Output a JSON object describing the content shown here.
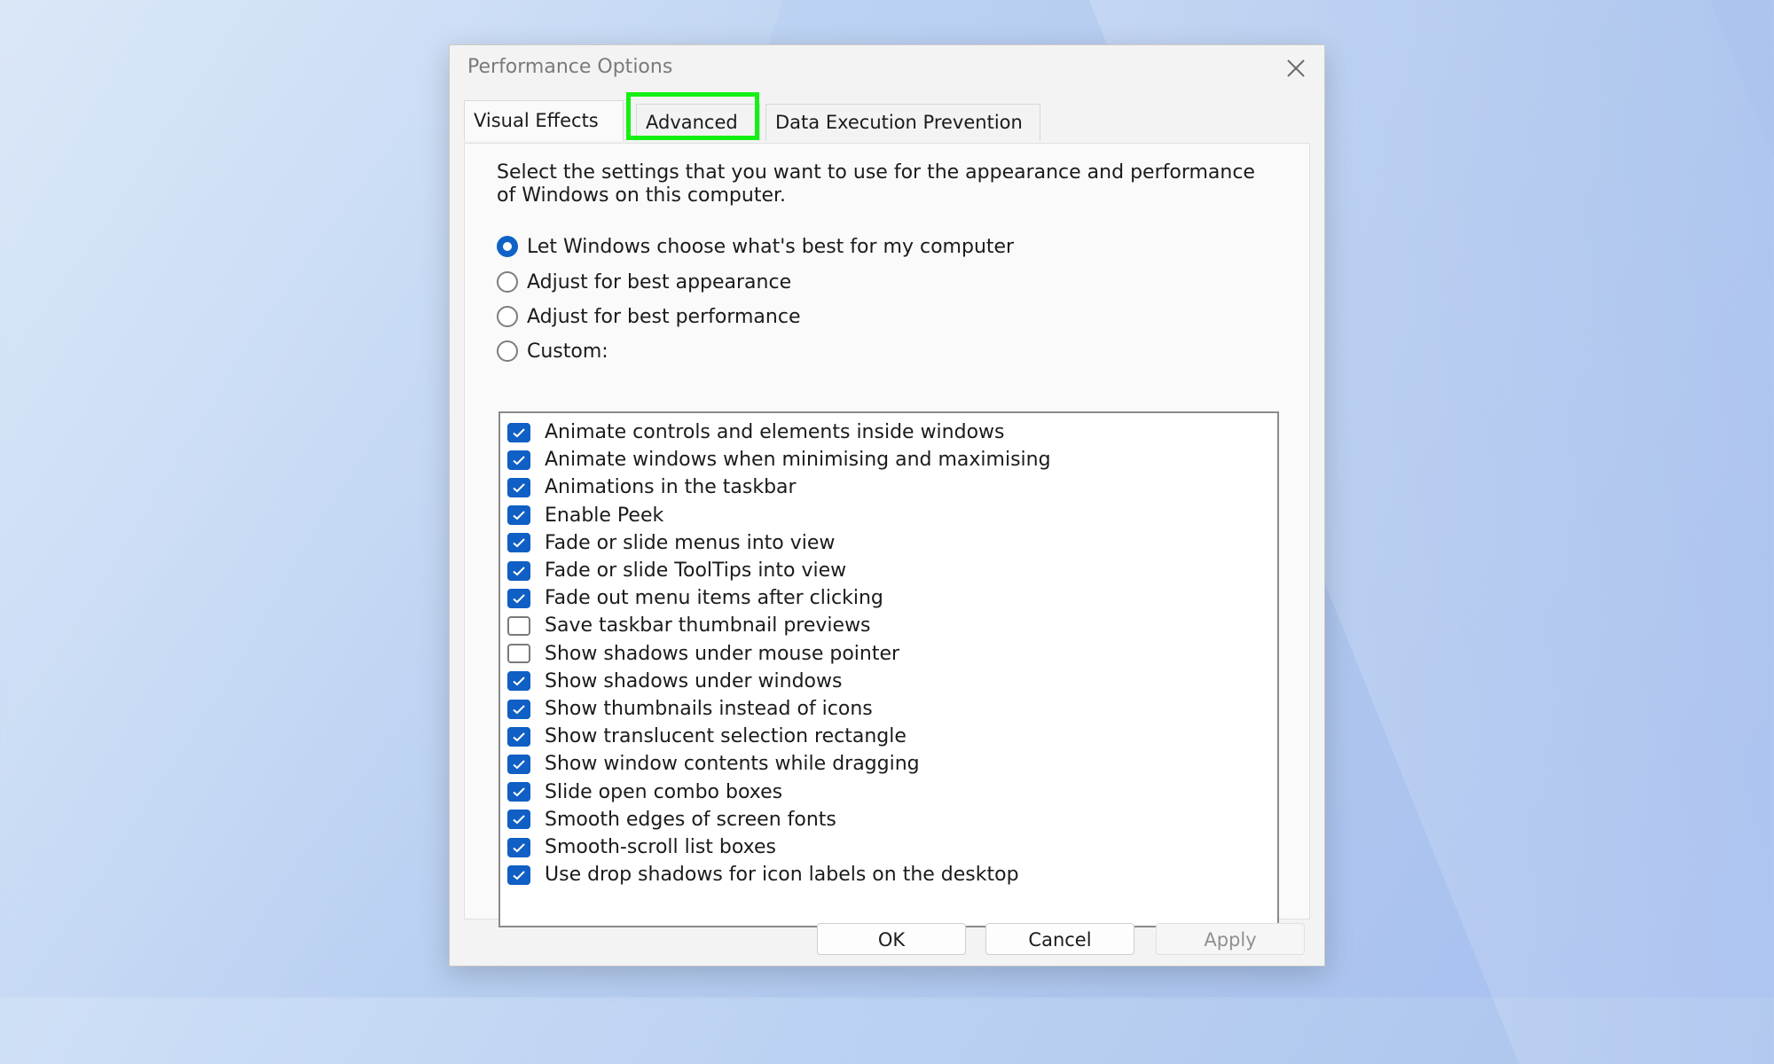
{
  "dialog": {
    "title": "Performance Options",
    "close_icon": "close-icon"
  },
  "tabs": [
    {
      "label": "Visual Effects",
      "active": true
    },
    {
      "label": "Advanced",
      "active": false,
      "highlighted": true
    },
    {
      "label": "Data Execution Prevention",
      "active": false
    }
  ],
  "highlight_color": "#14f014",
  "panel": {
    "description": "Select the settings that you want to use for the appearance and performance of Windows on this computer.",
    "radios": [
      {
        "label": "Let Windows choose what's best for my computer",
        "selected": true
      },
      {
        "label": "Adjust for best appearance",
        "selected": false
      },
      {
        "label": "Adjust for best performance",
        "selected": false
      },
      {
        "label": "Custom:",
        "selected": false
      }
    ],
    "checkboxes": [
      {
        "label": "Animate controls and elements inside windows",
        "checked": true
      },
      {
        "label": "Animate windows when minimising and maximising",
        "checked": true
      },
      {
        "label": "Animations in the taskbar",
        "checked": true
      },
      {
        "label": "Enable Peek",
        "checked": true
      },
      {
        "label": "Fade or slide menus into view",
        "checked": true
      },
      {
        "label": "Fade or slide ToolTips into view",
        "checked": true
      },
      {
        "label": "Fade out menu items after clicking",
        "checked": true
      },
      {
        "label": "Save taskbar thumbnail previews",
        "checked": false
      },
      {
        "label": "Show shadows under mouse pointer",
        "checked": false
      },
      {
        "label": "Show shadows under windows",
        "checked": true
      },
      {
        "label": "Show thumbnails instead of icons",
        "checked": true
      },
      {
        "label": "Show translucent selection rectangle",
        "checked": true
      },
      {
        "label": "Show window contents while dragging",
        "checked": true
      },
      {
        "label": "Slide open combo boxes",
        "checked": true
      },
      {
        "label": "Smooth edges of screen fonts",
        "checked": true
      },
      {
        "label": "Smooth-scroll list boxes",
        "checked": true
      },
      {
        "label": "Use drop shadows for icon labels on the desktop",
        "checked": true
      }
    ]
  },
  "buttons": {
    "ok": "OK",
    "cancel": "Cancel",
    "apply": "Apply"
  },
  "colors": {
    "accent": "#0f5fc4",
    "disabled_text": "#8f8f8f"
  }
}
